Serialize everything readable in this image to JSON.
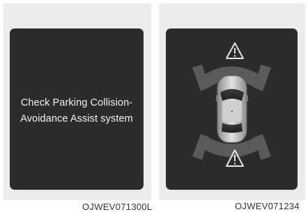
{
  "left_panel": {
    "message_line1": "Check Parking Collision-",
    "message_line2": "Avoidance Assist system",
    "code": "OJWEV071300L"
  },
  "right_panel": {
    "warning_front_icon": "warning-triangle-icon",
    "warning_rear_icon": "warning-triangle-icon",
    "car_icon": "car-top-view-icon",
    "code": "OJWEV071234"
  },
  "colors": {
    "screen_bg": "#2b2b2b",
    "panel_bg": "#ececec",
    "sensor_zone": "#5a5a5a",
    "text": "#f2f2f2"
  }
}
